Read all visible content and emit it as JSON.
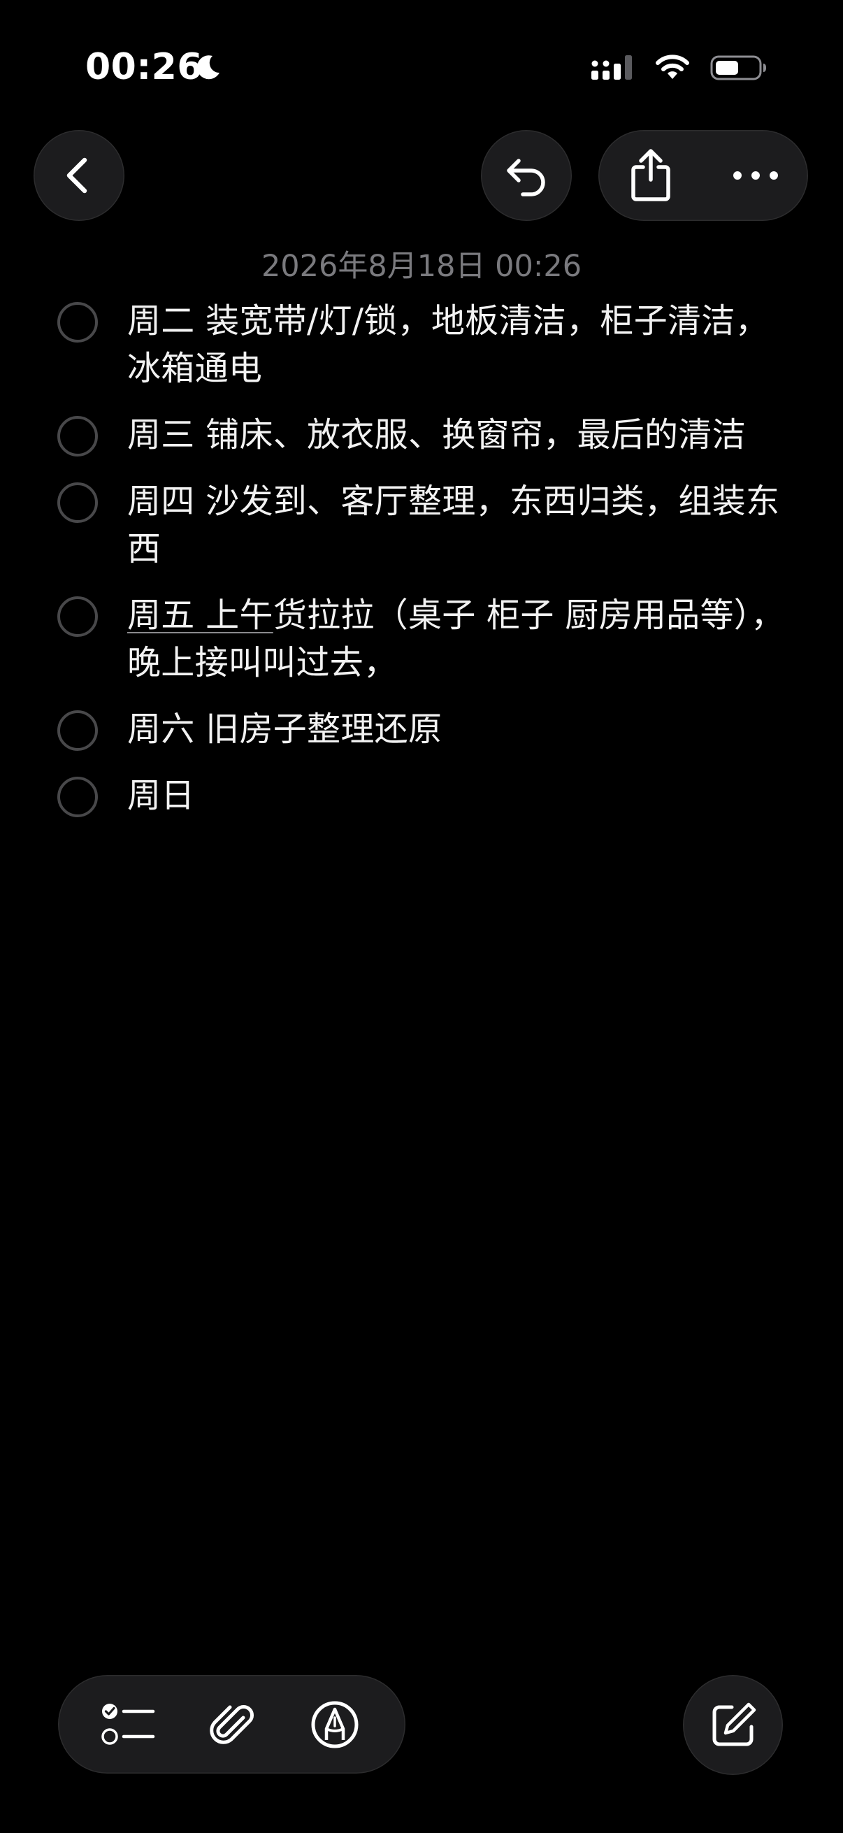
{
  "status_bar": {
    "time": "00:26",
    "focus_icon": "moon-icon",
    "signal_icon": "cellular-signal-icon",
    "wifi_icon": "wifi-icon",
    "battery_icon": "battery-icon"
  },
  "toolbar": {
    "back_icon": "chevron-left-icon",
    "undo_icon": "undo-icon",
    "share_icon": "share-icon",
    "more_icon": "ellipsis-icon"
  },
  "note": {
    "date": "2026年8月18日 00:26",
    "items": [
      {
        "text": "周二 装宽带/灯/锁，地板清洁，柜子清洁，冰箱通电",
        "checked": false
      },
      {
        "text": "周三 铺床、放衣服、换窗帘，最后的清洁",
        "checked": false
      },
      {
        "text": "周四 沙发到、客厅整理，东西归类，组装东西",
        "checked": false
      },
      {
        "text_underlined": "周五 上午",
        "text_rest": "货拉拉（桌子 柜子 厨房用品等），晚上接叫叫过去，",
        "checked": false
      },
      {
        "text": "周六 旧房子整理还原",
        "checked": false
      },
      {
        "text": "周日",
        "checked": false
      }
    ]
  },
  "bottom_bar": {
    "checklist_icon": "checklist-icon",
    "attachment_icon": "paperclip-icon",
    "markup_icon": "markup-pen-icon",
    "compose_icon": "compose-icon"
  },
  "colors": {
    "background": "#000000",
    "button_bg": "#1c1c1e",
    "date_text": "#7a7a7e",
    "checkbox_border": "#48484a"
  }
}
